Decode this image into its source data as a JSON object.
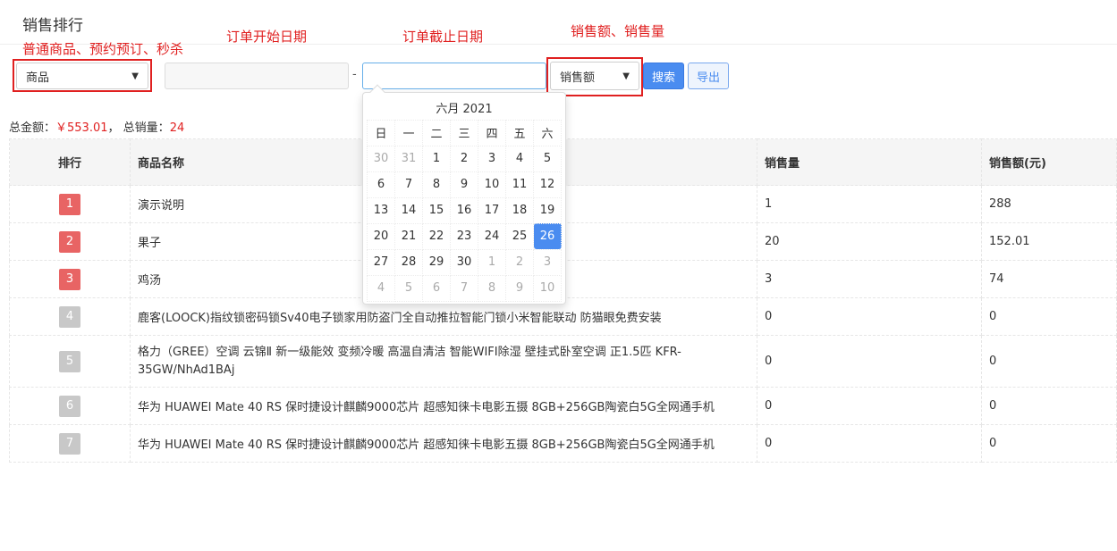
{
  "page": {
    "title": "销售排行"
  },
  "annotations": {
    "type_note": "普通商品、预约预订、秒杀",
    "start_note": "订单开始日期",
    "end_note": "订单截止日期",
    "metric_note": "销售额、销售量"
  },
  "filters": {
    "type_select": "商品",
    "start_date": {
      "value": "",
      "placeholder": ""
    },
    "end_date": {
      "value": "",
      "placeholder": ""
    },
    "separator": "-",
    "metric_select": "销售额",
    "search_label": "搜索",
    "export_label": "导出"
  },
  "summary": {
    "amount_label": "总金额：",
    "amount_value": "￥553.01",
    "sep": "，",
    "qty_label": "总销量：",
    "qty_value": "24"
  },
  "table": {
    "headers": [
      "排行",
      "商品名称",
      "销售量",
      "销售额(元)"
    ],
    "rows": [
      {
        "rank": "1",
        "name": "演示说明",
        "qty": "1",
        "amount": "288"
      },
      {
        "rank": "2",
        "name": "果子",
        "qty": "20",
        "amount": "152.01"
      },
      {
        "rank": "3",
        "name": "鸡汤",
        "qty": "3",
        "amount": "74"
      },
      {
        "rank": "4",
        "name": "鹿客(LOOCK)指纹锁密码锁Sv40电子锁家用防盗门全自动推拉智能门锁小米智能联动 防猫眼免费安装",
        "qty": "0",
        "amount": "0"
      },
      {
        "rank": "5",
        "name": "格力（GREE）空调 云锦Ⅱ 新一级能效 变频冷暖 高温自清洁 智能WIFI除湿 壁挂式卧室空调 正1.5匹 KFR-35GW/NhAd1BAj",
        "qty": "0",
        "amount": "0"
      },
      {
        "rank": "6",
        "name": "华为 HUAWEI Mate 40 RS 保时捷设计麒麟9000芯片 超感知徕卡电影五摄 8GB+256GB陶瓷白5G全网通手机",
        "qty": "0",
        "amount": "0"
      },
      {
        "rank": "7",
        "name": "华为 HUAWEI Mate 40 RS 保时捷设计麒麟9000芯片 超感知徕卡电影五摄 8GB+256GB陶瓷白5G全网通手机",
        "qty": "0",
        "amount": "0"
      }
    ]
  },
  "datepicker": {
    "title": "六月 2021",
    "weekdays": [
      "日",
      "一",
      "二",
      "三",
      "四",
      "五",
      "六"
    ],
    "weeks": [
      [
        "30",
        "31",
        "1",
        "2",
        "3",
        "4",
        "5"
      ],
      [
        "6",
        "7",
        "8",
        "9",
        "10",
        "11",
        "12"
      ],
      [
        "13",
        "14",
        "15",
        "16",
        "17",
        "18",
        "19"
      ],
      [
        "20",
        "21",
        "22",
        "23",
        "24",
        "25",
        "26"
      ],
      [
        "27",
        "28",
        "29",
        "30",
        "1",
        "2",
        "3"
      ],
      [
        "4",
        "5",
        "6",
        "7",
        "8",
        "9",
        "10"
      ]
    ],
    "selected": "26"
  },
  "colors": {
    "accent": "#4a8cf0",
    "annotation_red": "#e02020",
    "rank_top": "#e86464",
    "rank_other": "#c8c8c8"
  },
  "icons": {
    "select_caret": "chevron-down-icon"
  }
}
